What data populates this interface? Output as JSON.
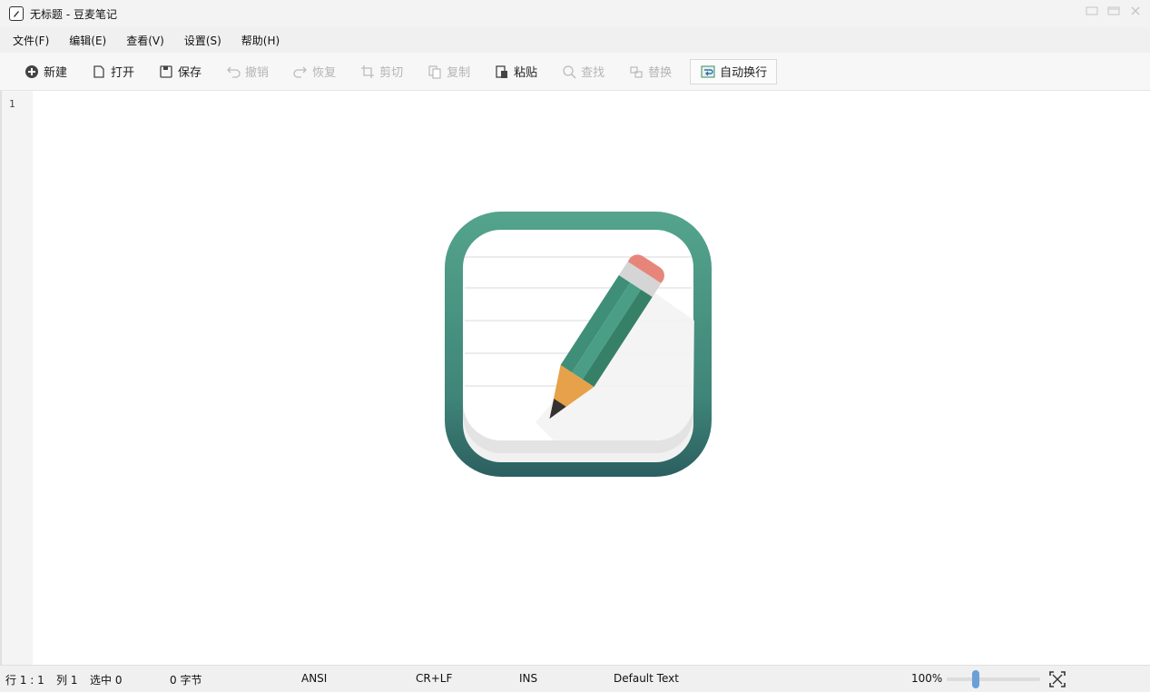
{
  "window": {
    "title": "无标题 - 豆麦笔记"
  },
  "menu": [
    "文件(F)",
    "编辑(E)",
    "查看(V)",
    "设置(S)",
    "帮助(H)"
  ],
  "toolbar": {
    "new": "新建",
    "open": "打开",
    "save": "保存",
    "undo": "撤销",
    "redo": "恢复",
    "cut": "剪切",
    "copy": "复制",
    "paste": "粘贴",
    "find": "查找",
    "replace": "替换",
    "wordwrap": "自动换行"
  },
  "editor": {
    "line_number": "1"
  },
  "status": {
    "row": "行 1 : 1",
    "col": "列 1",
    "selected": "选中 0",
    "bytes": "0 字节",
    "encoding": "ANSI",
    "line_ending": "CR+LF",
    "mode": "INS",
    "syntax": "Default Text",
    "zoom": "100%"
  },
  "colors": {
    "accent": "#4d9a86",
    "pencil_body": "#3f8f78",
    "pencil_tip": "#e7a14a",
    "eraser": "#e8857a"
  }
}
